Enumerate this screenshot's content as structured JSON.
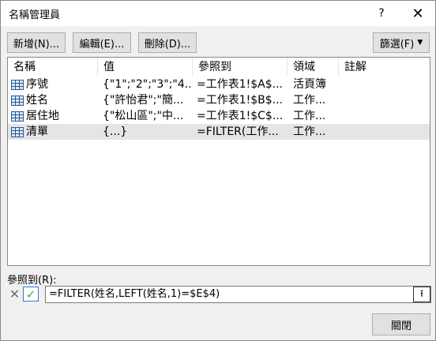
{
  "window": {
    "title": "名稱管理員",
    "help_icon": "?",
    "close_icon": "✕"
  },
  "toolbar": {
    "new_label": "新增(N)...",
    "edit_label": "編輯(E)...",
    "delete_label": "刪除(D)...",
    "filter_label": "篩選(F)"
  },
  "list": {
    "columns": [
      "名稱",
      "值",
      "參照到",
      "領域",
      "註解"
    ],
    "rows": [
      {
        "name": "序號",
        "value": "{\"1\";\"2\";\"3\";\"4...",
        "refers_to": "=工作表1!$A$...",
        "scope": "活頁簿",
        "comment": "",
        "icon": "table-icon"
      },
      {
        "name": "姓名",
        "value": "{\"許怡君\";\"簡...",
        "refers_to": "=工作表1!$B$...",
        "scope": "工作...",
        "comment": "",
        "icon": "table-icon"
      },
      {
        "name": "居住地",
        "value": "{\"松山區\";\"中...",
        "refers_to": "=工作表1!$C$...",
        "scope": "工作...",
        "comment": "",
        "icon": "table-icon"
      },
      {
        "name": "清單",
        "value": "{...}",
        "refers_to": "=FILTER(工作...",
        "scope": "工作...",
        "comment": "",
        "icon": "table-icon"
      }
    ]
  },
  "refers": {
    "label": "參照到(R):",
    "value": "=FILTER(姓名,LEFT(姓名,1)=$E$4)"
  },
  "footer": {
    "close_label": "關閉"
  },
  "colors": {
    "selected_row": "#e5e5e5",
    "accent": "#2b79d0"
  }
}
